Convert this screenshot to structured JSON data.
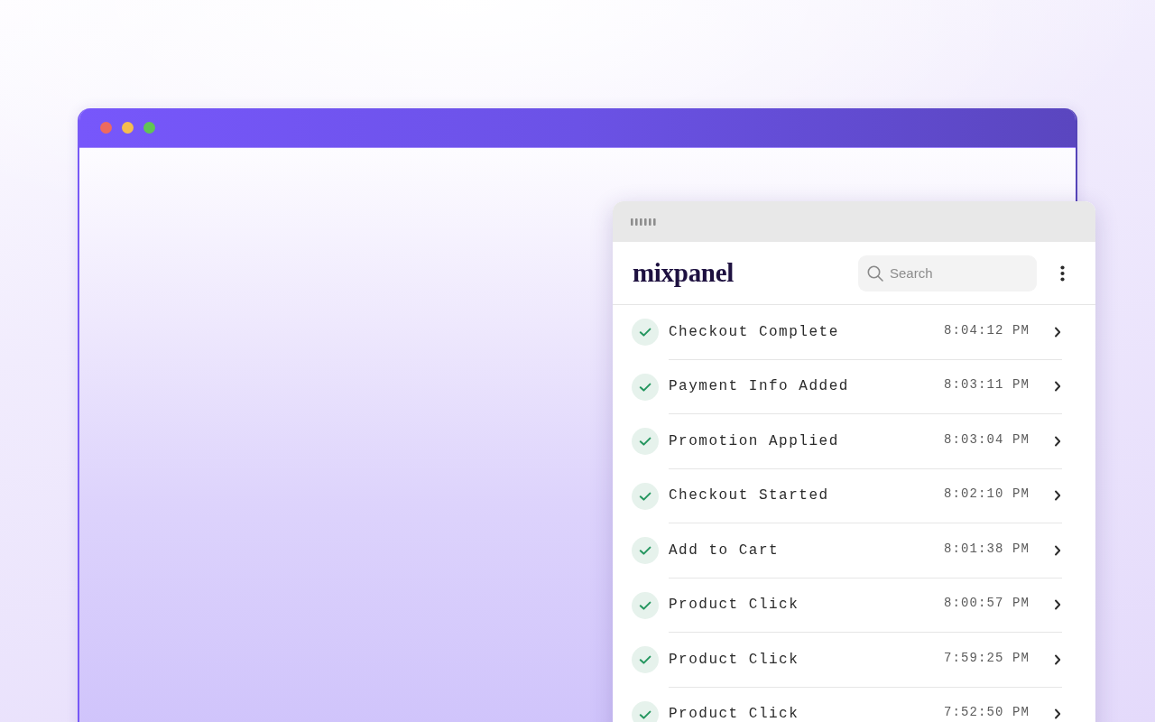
{
  "browser_window": {
    "traffic_lights": [
      {
        "color": "#ee6a5f"
      },
      {
        "color": "#f5bd4f"
      },
      {
        "color": "#61c454"
      }
    ]
  },
  "panel": {
    "logo": "mixpanel",
    "search": {
      "placeholder": "Search"
    },
    "events": [
      {
        "name": "Checkout Complete",
        "time": "8:04:12 PM",
        "done": true
      },
      {
        "name": "Payment Info Added",
        "time": "8:03:11 PM",
        "done": true
      },
      {
        "name": "Promotion Applied",
        "time": "8:03:04 PM",
        "done": true
      },
      {
        "name": "Checkout Started",
        "time": "8:02:10 PM",
        "done": true
      },
      {
        "name": "Add to Cart",
        "time": "8:01:38 PM",
        "done": true
      },
      {
        "name": "Product Click",
        "time": "8:00:57 PM",
        "done": true
      },
      {
        "name": "Product Click",
        "time": "7:59:25 PM",
        "done": true
      },
      {
        "name": "Product Click",
        "time": "7:52:50 PM",
        "done": true
      }
    ]
  }
}
